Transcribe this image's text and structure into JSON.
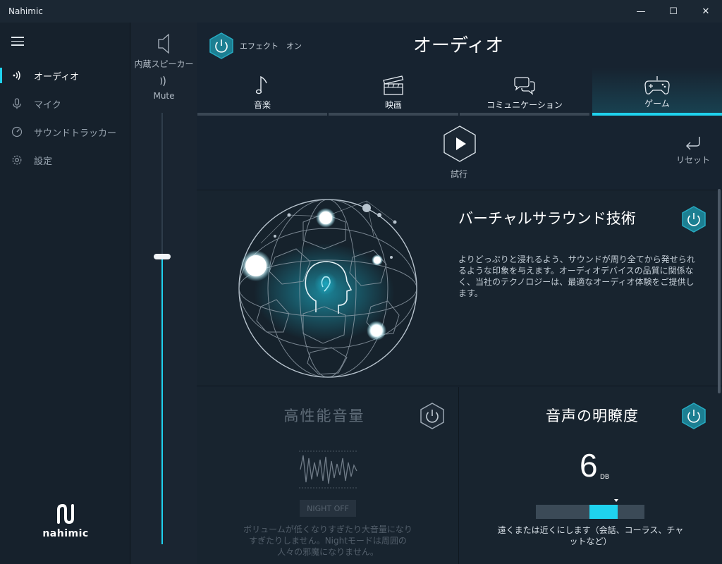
{
  "window": {
    "title": "Nahimic",
    "minimize": "—",
    "maximize": "☐",
    "close": "✕"
  },
  "nav": {
    "items": [
      {
        "label": "オーディオ",
        "icon": "audio-wave-icon",
        "active": true
      },
      {
        "label": "マイク",
        "icon": "microphone-icon",
        "active": false
      },
      {
        "label": "サウンドトラッカー",
        "icon": "sound-tracker-icon",
        "active": false
      },
      {
        "label": "設定",
        "icon": "gear-icon",
        "active": false
      }
    ],
    "logo_text": "nahimic"
  },
  "device": {
    "name": "内蔵スピーカー",
    "mute_label": "Mute",
    "volume_fraction": 0.66
  },
  "header": {
    "effect_label": "エフェクト　オン",
    "title": "オーディオ"
  },
  "tabs": [
    {
      "label": "音楽",
      "icon": "music-note-icon",
      "active": false
    },
    {
      "label": "映画",
      "icon": "clapperboard-icon",
      "active": false
    },
    {
      "label": "コミュニケーション",
      "icon": "chat-bubbles-icon",
      "active": false
    },
    {
      "label": "ゲーム",
      "icon": "gamepad-icon",
      "active": true
    }
  ],
  "controls": {
    "play_label": "試行",
    "reset_label": "リセット"
  },
  "surround": {
    "title": "バーチャルサラウンド技術",
    "description": "よりどっぷりと浸れるよう、サウンドが周り全てから発せられるような印象を与えます。オーディオデバイスの品質に関係なく、当社のテクノロジーは、最適なオーディオ体験をご提供します。"
  },
  "high_perf": {
    "title": "高性能音量",
    "night_button": "NIGHT OFF",
    "description": "ボリュームが低くなりすぎたり大音量になりすぎたりしません。Nightモードは周囲の人々の邪魔になりません。"
  },
  "voice_clarity": {
    "title": "音声の明瞭度",
    "value": "6",
    "unit": "DB",
    "level_fraction": 0.75,
    "description": "遠くまたは近くにします（会話、コーラス、チャットなど）"
  },
  "colors": {
    "accent": "#1fd2ee",
    "background": "#172330",
    "nav_bg": "#16212c"
  }
}
